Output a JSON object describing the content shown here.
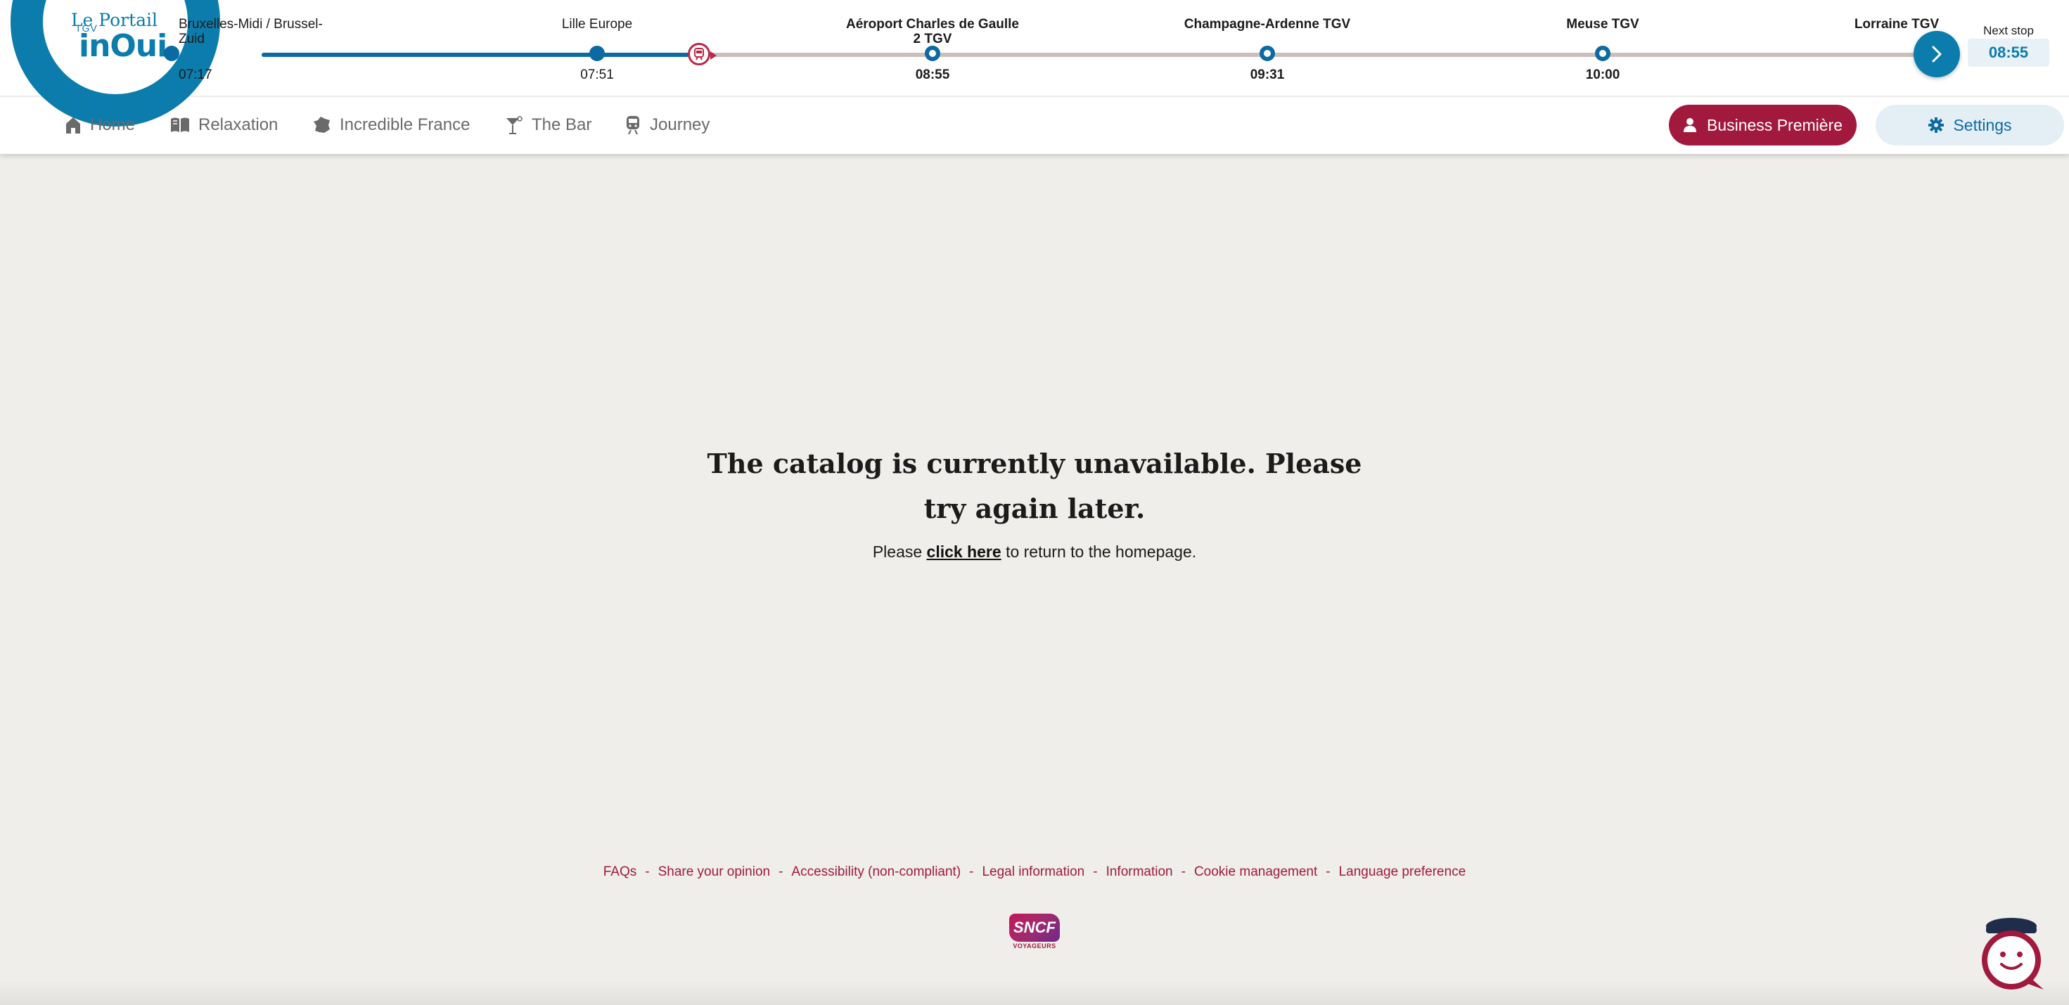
{
  "brand": {
    "title": "Le Portail",
    "sub": "TGV",
    "name": "inOui"
  },
  "journey": {
    "stops": [
      {
        "name": "Bruxelles-Midi / Brussel-Zuid",
        "time": "07:17",
        "status": "past"
      },
      {
        "name": "Lille Europe",
        "time": "07:51",
        "status": "past"
      },
      {
        "name": "Aéroport Charles de Gaulle 2 TGV",
        "time": "08:55",
        "status": "next"
      },
      {
        "name": "Champagne-Ardenne TGV",
        "time": "09:31",
        "status": "future"
      },
      {
        "name": "Meuse TGV",
        "time": "10:00",
        "status": "future"
      },
      {
        "name": "Lorraine TGV",
        "time": "",
        "status": "future"
      }
    ],
    "next_stop_label": "Next stop",
    "next_stop_time": "08:55"
  },
  "nav": {
    "items": [
      {
        "label": "Home",
        "icon": "house-icon"
      },
      {
        "label": "Relaxation",
        "icon": "book-icon"
      },
      {
        "label": "Incredible France",
        "icon": "france-map-icon"
      },
      {
        "label": "The Bar",
        "icon": "cocktail-icon"
      },
      {
        "label": "Journey",
        "icon": "train-icon"
      }
    ],
    "class_button": "Business Première",
    "settings_button": "Settings"
  },
  "message": {
    "title": "The catalog is currently unavailable. Please try again later.",
    "text_before": "Please",
    "link": "click here",
    "text_after": "to return to the homepage."
  },
  "footer": {
    "links": [
      "FAQs",
      "Share your opinion",
      "Accessibility (non-compliant)",
      "Legal information",
      "Information",
      "Cookie management",
      "Language preference"
    ],
    "separator": "-",
    "logo_text": "SNCF",
    "logo_sub": "VOYAGEURS"
  },
  "colors": {
    "accent_blue": "#0c7cac",
    "brand_red": "#a1193d",
    "background": "#efeeeb"
  }
}
